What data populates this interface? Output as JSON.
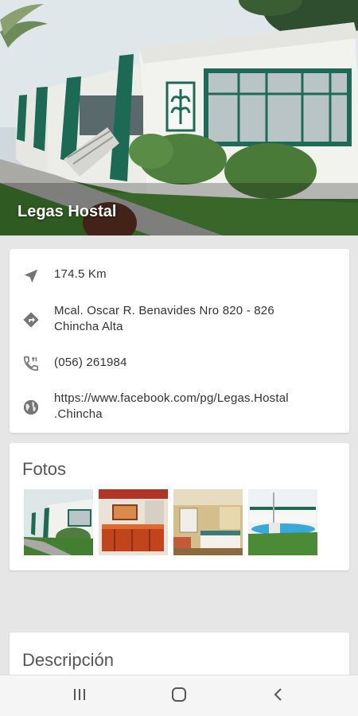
{
  "hero": {
    "title": "Legas Hostal"
  },
  "info": {
    "distance": "174.5 Km",
    "address_line1": "Mcal. Oscar R. Benavides Nro 820 - 826",
    "address_line2": "Chincha Alta",
    "phone": "(056) 261984",
    "url_line1": "https://www.facebook.com/pg/Legas.Hostal",
    "url_line2": ".Chincha"
  },
  "photos": {
    "heading": "Fotos",
    "items": [
      {
        "name": "hostal-exterior"
      },
      {
        "name": "reception"
      },
      {
        "name": "room"
      },
      {
        "name": "pool"
      }
    ]
  },
  "description": {
    "heading": "Descripción"
  },
  "colors": {
    "accent_green": "#1e6b55",
    "icon_gray": "#757575"
  },
  "icons": [
    "navigation-arrow-icon",
    "directions-icon",
    "phone-icon",
    "globe-icon",
    "recent-apps-icon",
    "home-icon",
    "back-icon"
  ]
}
